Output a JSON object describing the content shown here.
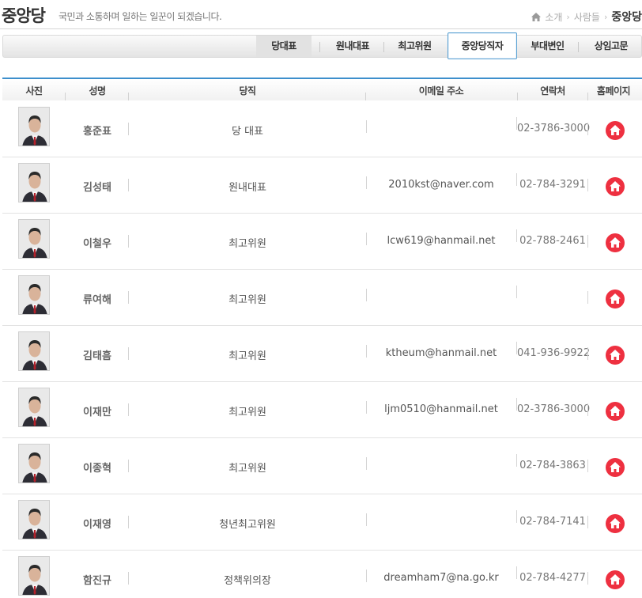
{
  "header": {
    "title": "중앙당",
    "subtitle": "국민과 소통하며 일하는 일꾼이 되겠습니다.",
    "breadcrumb": [
      "소개",
      "사람들",
      "중앙당"
    ]
  },
  "tabs": [
    {
      "label": "당대표",
      "active": false
    },
    {
      "label": "원내대표",
      "active": false
    },
    {
      "label": "최고위원",
      "active": false
    },
    {
      "label": "중앙당직자",
      "active": true
    },
    {
      "label": "부대변인",
      "active": false
    },
    {
      "label": "상임고문",
      "active": false
    }
  ],
  "table": {
    "columns": [
      "사진",
      "성명",
      "당직",
      "이메일 주소",
      "연락처",
      "홈페이지"
    ],
    "rows": [
      {
        "name": "홍준표",
        "position": "당 대표",
        "email": "",
        "phone": "02-3786-3000",
        "photo_icon": "person-photo-icon"
      },
      {
        "name": "김성태",
        "position": "원내대표",
        "email": "2010kst@naver.com",
        "phone": "02-784-3291",
        "photo_icon": "person-photo-icon"
      },
      {
        "name": "이철우",
        "position": "최고위원",
        "email": "lcw619@hanmail.net",
        "phone": "02-788-2461",
        "photo_icon": "person-photo-icon"
      },
      {
        "name": "류여해",
        "position": "최고위원",
        "email": "",
        "phone": "",
        "photo_icon": "person-photo-icon"
      },
      {
        "name": "김태흠",
        "position": "최고위원",
        "email": "ktheum@hanmail.net",
        "phone": "041-936-9922",
        "photo_icon": "person-photo-icon"
      },
      {
        "name": "이재만",
        "position": "최고위원",
        "email": "ljm0510@hanmail.net",
        "phone": "02-3786-3000",
        "photo_icon": "person-photo-icon"
      },
      {
        "name": "이종혁",
        "position": "최고위원",
        "email": "",
        "phone": "02-784-3863",
        "photo_icon": "person-photo-icon"
      },
      {
        "name": "이재영",
        "position": "청년최고위원",
        "email": "",
        "phone": "02-784-7141",
        "photo_icon": "person-photo-icon"
      },
      {
        "name": "함진규",
        "position": "정책위의장",
        "email": "dreamham7@na.go.kr",
        "phone": "02-784-4277",
        "photo_icon": "person-photo-icon"
      }
    ]
  },
  "colors": {
    "accent_blue": "#3d8fcc",
    "homepage_red": "#ee3040",
    "tab_active_border": "#5aa1d3"
  },
  "icons": {
    "breadcrumb_home": "home-icon",
    "homepage": "house-icon"
  }
}
